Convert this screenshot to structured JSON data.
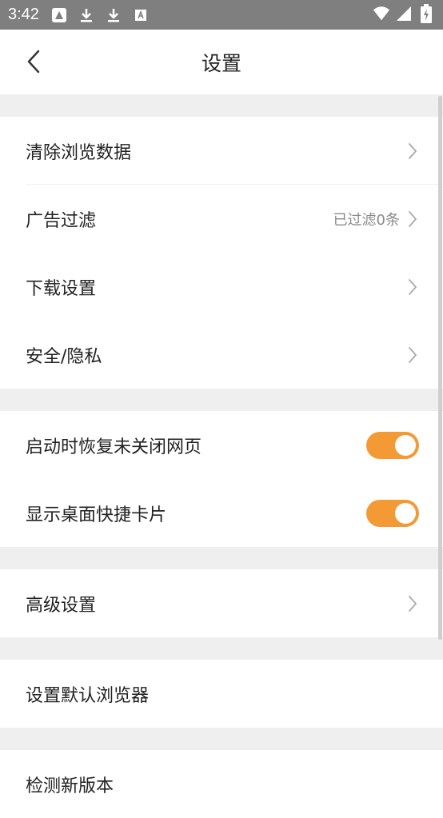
{
  "status_bar": {
    "time": "3:42",
    "icons_left": [
      "app-icon",
      "download-icon",
      "download-icon",
      "text-icon"
    ],
    "icons_right": [
      "wifi-icon",
      "signal-icon",
      "battery-icon"
    ]
  },
  "header": {
    "title": "设置",
    "back_icon": "chevron-left-icon"
  },
  "groups": [
    {
      "items": [
        {
          "label": "清除浏览数据",
          "value": "",
          "control": "chevron"
        },
        {
          "label": "广告过滤",
          "value": "已过滤0条",
          "control": "chevron"
        },
        {
          "label": "下载设置",
          "value": "",
          "control": "chevron"
        },
        {
          "label": "安全/隐私",
          "value": "",
          "control": "chevron"
        }
      ]
    },
    {
      "items": [
        {
          "label": "启动时恢复未关闭网页",
          "control": "toggle",
          "on": true
        },
        {
          "label": "显示桌面快捷卡片",
          "control": "toggle",
          "on": true
        }
      ]
    },
    {
      "items": [
        {
          "label": "高级设置",
          "control": "chevron"
        }
      ]
    },
    {
      "items": [
        {
          "label": "设置默认浏览器",
          "control": "none"
        }
      ]
    },
    {
      "items": [
        {
          "label": "检测新版本",
          "control": "none"
        }
      ]
    }
  ],
  "colors": {
    "accent": "#f39a34",
    "background": "#efefef",
    "status_bar": "#7f7f7f"
  }
}
